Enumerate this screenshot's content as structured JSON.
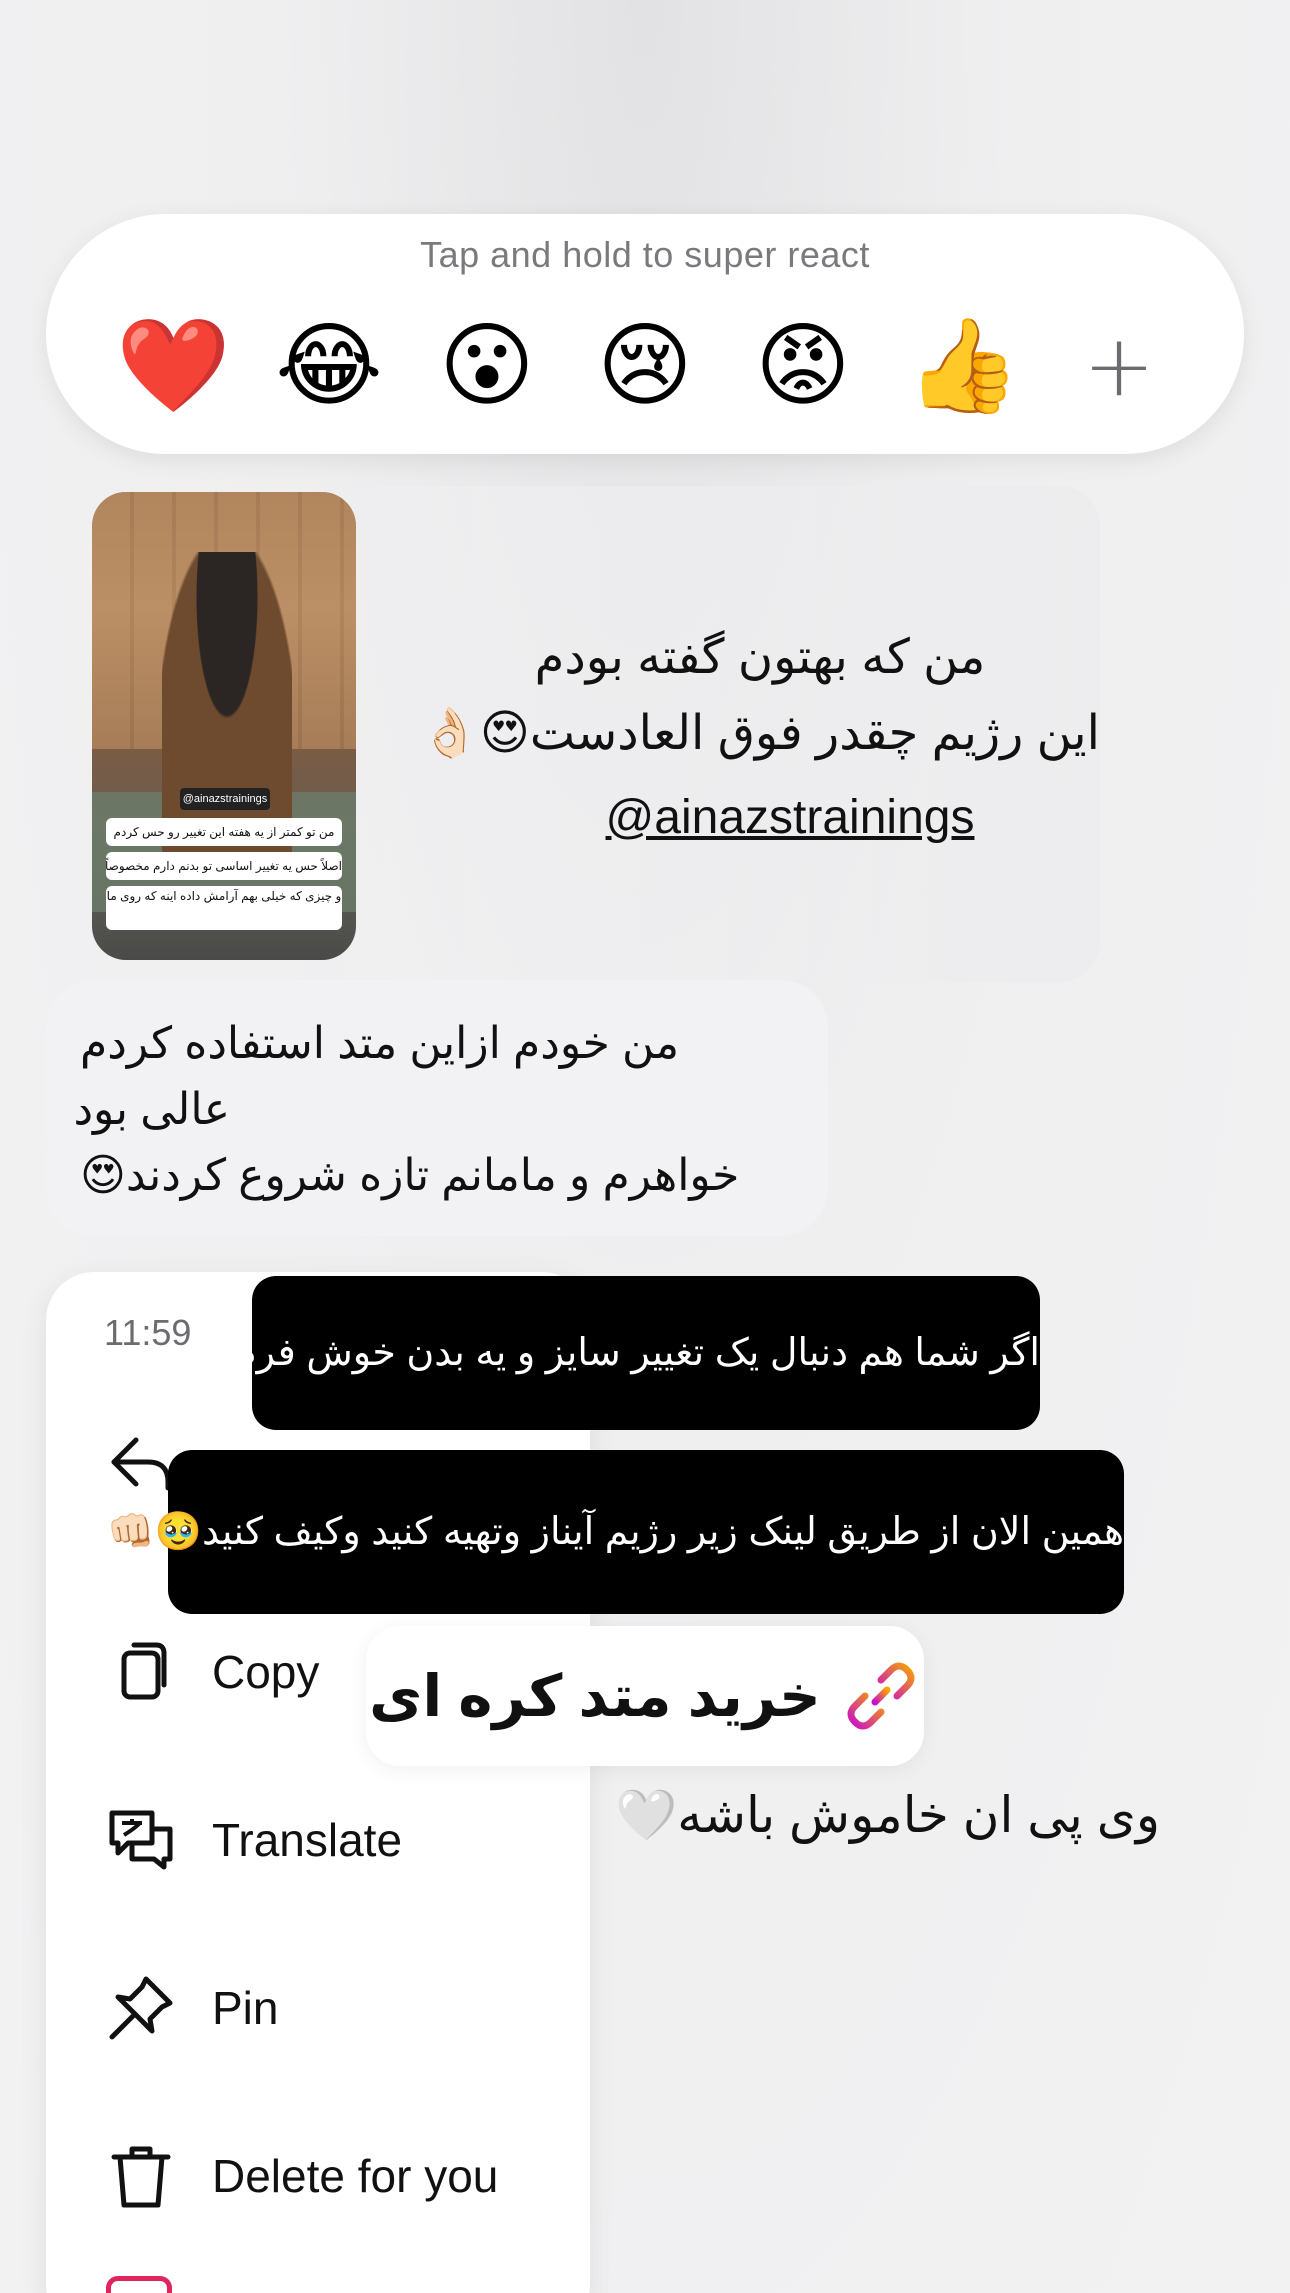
{
  "reaction_bar": {
    "hint": "Tap and hold to super react",
    "reactions": [
      {
        "emoji": "❤️",
        "name": "red-heart"
      },
      {
        "emoji": "😂",
        "name": "tears-of-joy"
      },
      {
        "emoji": "😮",
        "name": "surprised"
      },
      {
        "emoji": "😢",
        "name": "crying"
      },
      {
        "emoji": "😡",
        "name": "angry"
      },
      {
        "emoji": "👍",
        "name": "thumbs-up"
      }
    ],
    "more": "+"
  },
  "story_share": {
    "thumbnail_tag": "@ainazstrainings",
    "thumbnail_captions": [
      "من تو کمتر از یه هفته این تغییر رو حس کردم",
      "اصلاً حس یه تغییر اساسی تو بدنم دارم مخصوصاً شکم و کمر",
      "و چیزی که خیلی بهم آرامش داده اینه که روی ما"
    ],
    "text_line1": "من که بهتون گفته بودم",
    "text_line2": "این رژیم چقدر فوق العادست😍👌🏻",
    "mention": "@ainazstrainings"
  },
  "incoming_message": {
    "lines": [
      "من خودم ازاین متد استفاده کردم",
      "عالی بود",
      "خواهرم و مامانم تازه شروع کردند😍"
    ]
  },
  "context_menu": {
    "time": "11:59",
    "items": [
      {
        "label": "Copy",
        "icon": "copy-icon"
      },
      {
        "label": "Translate",
        "icon": "translate-icon"
      },
      {
        "label": "Pin",
        "icon": "pin-icon"
      },
      {
        "label": "Delete for you",
        "icon": "trash-icon"
      }
    ]
  },
  "story_reply": {
    "bubble1": "اگر شما هم دنبال یک تغییر سایز و یه بدن خوش فرم اید",
    "bubble2": "همین الان از طریق لینک زیر رژیم آیناز وتهیه کنید وکیف کنید🥹👊🏻",
    "link_text": "خرید متد کره ای",
    "caption": "وی پی ان خاموش باشه🤍"
  },
  "colors": {
    "background": "#ededee",
    "menu_bg": "#ffffff",
    "dark_bubble": "#000000",
    "link_gradient_start": "#f7a500",
    "link_gradient_end": "#c90ec9"
  }
}
